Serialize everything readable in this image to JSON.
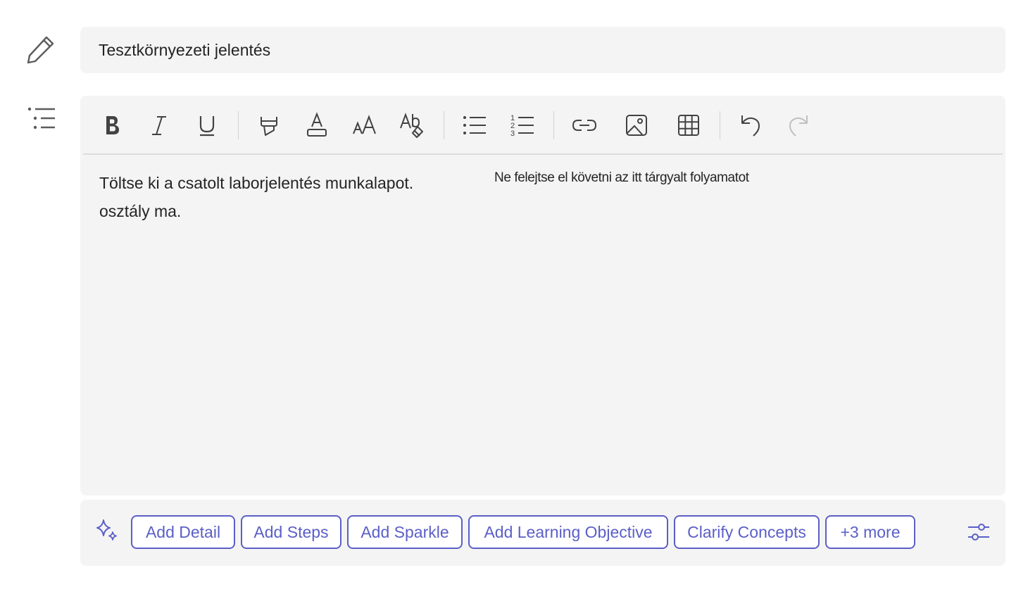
{
  "title": {
    "value": "Tesztkörnyezeti jelentés"
  },
  "toolbar": {
    "bold": "bold-icon",
    "italic": "italic-icon",
    "underline": "underline-icon",
    "highlight": "highlight-icon",
    "font_color": "font-color-icon",
    "font_size": "font-size-icon",
    "clear_format": "clear-formatting-icon",
    "bullets": "bulleted-list-icon",
    "numbering": "numbered-list-icon",
    "link": "link-icon",
    "image": "image-icon",
    "table": "table-icon",
    "undo": "undo-icon",
    "redo": "redo-icon"
  },
  "editor": {
    "line1": "Töltse ki a csatolt laborjelentés munkalapot.",
    "line2": "osztály ma.",
    "note": "Ne felejtse el követni az itt tárgyalt folyamatot"
  },
  "ai": {
    "chips": [
      "Add Detail",
      "Add Steps",
      "Add Sparkle",
      "Add Learning Objective",
      "Clarify Concepts",
      "+3 more"
    ]
  },
  "colors": {
    "accent": "#5b5fc7",
    "panel": "#f4f4f4",
    "text": "#242424",
    "disabled": "#c0c0c0"
  }
}
